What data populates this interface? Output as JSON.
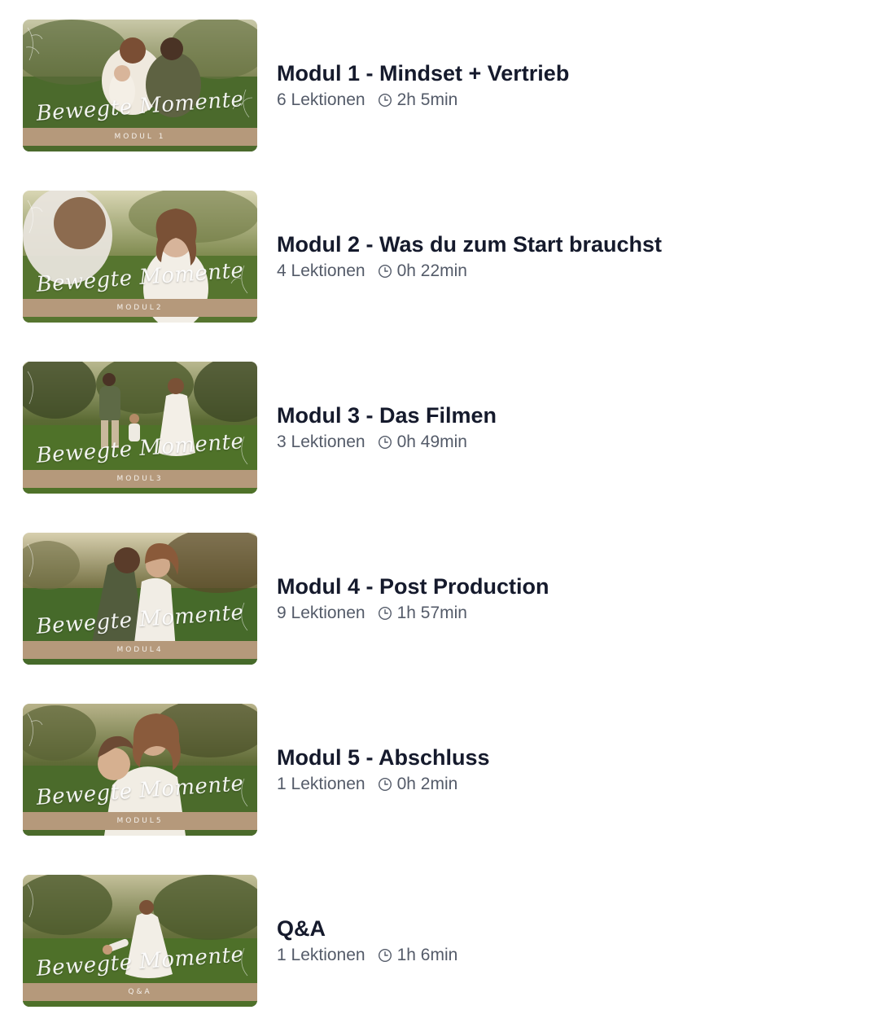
{
  "modules": [
    {
      "thumb_script": "Bewegte Momente",
      "thumb_band": "MODUL 1",
      "title": "Modul 1 - Mindset + Vertrieb",
      "lessons": "6 Lektionen",
      "duration": "2h 5min"
    },
    {
      "thumb_script": "Bewegte Momente",
      "thumb_band": "MODUL2",
      "title": "Modul 2 - Was du zum Start brauchst",
      "lessons": "4 Lektionen",
      "duration": "0h 22min"
    },
    {
      "thumb_script": "Bewegte Momente",
      "thumb_band": "MODUL3",
      "title": "Modul 3 - Das Filmen",
      "lessons": "3 Lektionen",
      "duration": "0h 49min"
    },
    {
      "thumb_script": "Bewegte Momente",
      "thumb_band": "MODUL4",
      "title": "Modul 4 - Post Production",
      "lessons": "9 Lektionen",
      "duration": "1h 57min"
    },
    {
      "thumb_script": "Bewegte Momente",
      "thumb_band": "MODUL5",
      "title": "Modul 5 - Abschluss",
      "lessons": "1 Lektionen",
      "duration": "0h 2min"
    },
    {
      "thumb_script": "Bewegte Momente",
      "thumb_band": "Q&A",
      "title": "Q&A",
      "lessons": "1 Lektionen",
      "duration": "1h 6min"
    }
  ],
  "icons": {
    "duration": "clock-icon"
  },
  "colors": {
    "title": "#151a2c",
    "meta": "#545b69",
    "band": "#b5997b"
  }
}
